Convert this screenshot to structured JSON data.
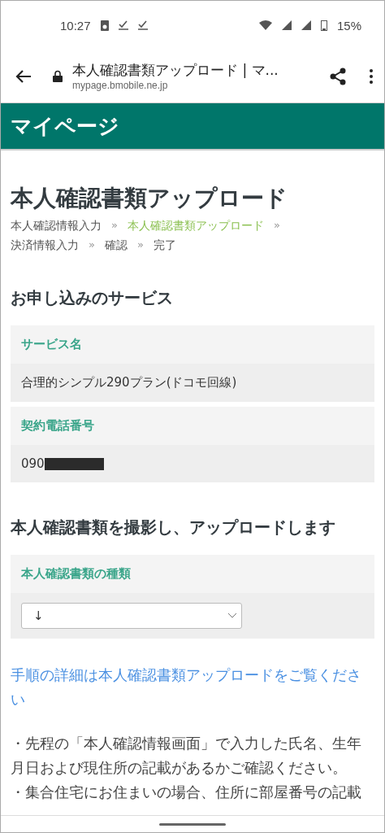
{
  "status_bar": {
    "time": "10:27",
    "battery": "15%"
  },
  "browser": {
    "title": "本人確認書類アップロード | マ...",
    "url": "mypage.bmobile.ne.jp"
  },
  "header": {
    "title": "マイページ"
  },
  "page_title": "本人確認書類アップロード",
  "breadcrumb": {
    "separator": "»",
    "steps": [
      {
        "label": "本人確認情報入力",
        "selected": false
      },
      {
        "label": "本人確認書類アップロード",
        "selected": true
      },
      {
        "label": "決済情報入力",
        "selected": false
      },
      {
        "label": "確認",
        "selected": false
      },
      {
        "label": "完了",
        "selected": false
      }
    ]
  },
  "service_section": {
    "heading": "お申し込みのサービス",
    "fields": [
      {
        "label": "サービス名",
        "value": "合理的シンプル290プラン(ドコモ回線)",
        "redacted": false
      },
      {
        "label": "契約電話番号",
        "value": "090",
        "redacted": true
      }
    ]
  },
  "upload_section": {
    "heading": "本人確認書類を撮影し、アップロードします",
    "document_type": {
      "label": "本人確認書類の種類",
      "value": "↓"
    }
  },
  "help_link": "手順の詳細は本人確認書類アップロードをご覧ください",
  "notes": [
    "・先程の「本人確認情報画面」で入力した氏名、生年月日および現住所の記載があるかご確認ください。",
    "・集合住宅にお住まいの場合、住所に部屋番号の記載"
  ]
}
